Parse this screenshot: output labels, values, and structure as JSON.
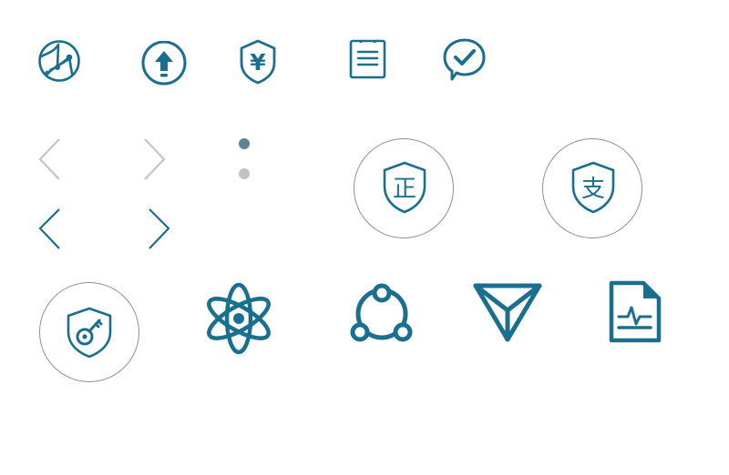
{
  "colors": {
    "primary": "#1a6f8f",
    "light": "#c2c6c8",
    "dot_active": "#5f8194",
    "dot_inactive": "#bfc3c6",
    "ring": "#8f8f8f"
  },
  "row1": {
    "icons": [
      "globe-network-icon",
      "upload-icon",
      "shield-yen-icon",
      "clipboard-list-icon",
      "chat-check-icon"
    ],
    "yen_char": "¥"
  },
  "row2": {
    "arrows": [
      "chevron-left-light-icon",
      "chevron-right-light-icon",
      "chevron-left-dark-icon",
      "chevron-right-dark-icon"
    ],
    "pagination_dots": [
      {
        "state": "active"
      },
      {
        "state": "inactive"
      }
    ],
    "shield_zheng_char": "正",
    "shield_zhi_char": "支"
  },
  "row3": {
    "icons": [
      "shield-key-icon",
      "atom-icon",
      "share-nodes-icon",
      "triangle-y-logo-icon",
      "document-pulse-icon"
    ]
  }
}
